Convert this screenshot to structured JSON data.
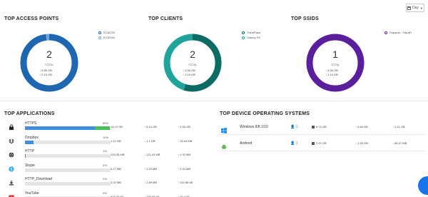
{
  "time_filter": {
    "value": "Day"
  },
  "sections": {
    "top_access_points": {
      "title": "TOP ACCESS POINTS",
      "total": "2",
      "total_label": "TOTAL",
      "down": "4.56 GB",
      "up": "2.19 GB",
      "legend": [
        "ECW230",
        "ECW160"
      ],
      "segments": [
        0.98,
        0.02
      ],
      "colors": [
        "#1f66b1",
        "#6aa6dc"
      ]
    },
    "top_clients": {
      "title": "TOP CLIENTS",
      "total": "2",
      "total_label": "TOTAL",
      "down": "4.56 GB",
      "up": "2.19 GB",
      "legend": [
        "ThinkPape",
        "Galaxy-S9"
      ],
      "segments": [
        0.55,
        0.45
      ],
      "colors": [
        "#0d6b64",
        "#20a39a"
      ]
    },
    "top_ssids": {
      "title": "TOP SSIDS",
      "total": "1",
      "total_label": "TOTAL",
      "down": "4.56 GB",
      "up": "2.19 GB",
      "legend": [
        "Papanet - PapaFi"
      ],
      "segments": [
        1.0
      ],
      "colors": [
        "#5b1f9e"
      ]
    }
  },
  "top_applications": {
    "title": "TOP APPLICATIONS",
    "rows": [
      {
        "name": "HTTPS",
        "pct": "89%",
        "total": "10.19 GB",
        "down": "8.14 GB",
        "up": "2.05 GB",
        "icon": "lock-icon",
        "blue": 0.82,
        "green": 0.17
      },
      {
        "name": "Dropbox",
        "pct": "10%",
        "total": "1.12 GB",
        "down": "1.1 GB",
        "up": "18.44 MB",
        "icon": "dropbox-icon",
        "blue": 0.1,
        "green": 0.0
      },
      {
        "name": "HTTP",
        "pct": "1%",
        "total": "126.35 MB",
        "down": "121.43 MB",
        "up": "4.92 MB",
        "icon": "globe-icon",
        "blue": 0.01,
        "green": 0.0
      },
      {
        "name": "Skype",
        "pct": "0%",
        "total": "5.27 MB",
        "down": "3.23 MB",
        "up": "2.04 MB",
        "icon": "skype-icon",
        "blue": 0.0,
        "green": 0.0
      },
      {
        "name": "HTTP_Download",
        "pct": "0%",
        "total": "3.02 MB",
        "down": "2.89 MB",
        "up": "132.86 kB",
        "icon": "download-icon",
        "blue": 0.0,
        "green": 0.0
      },
      {
        "name": "YouTube",
        "pct": "0%",
        "total": "825.05 kB",
        "down": "798.65 kB",
        "up": "26.4 kB",
        "icon": "youtube-icon",
        "blue": 0.0,
        "green": 0.0
      }
    ]
  },
  "top_device_os": {
    "title": "TOP DEVICE OPERATING SYSTEMS",
    "rows": [
      {
        "name": "Windows 8/8.1/10",
        "count": "1",
        "total": "6.74 GB",
        "down": "4.63 GB",
        "up": "2.11 GB",
        "icon": "windows-icon",
        "color": "#1e88e5"
      },
      {
        "name": "Android",
        "count": "1",
        "total": "2.02 GB",
        "down": "1.93 GB",
        "up": "86.47 MB",
        "icon": "android-icon",
        "color": "#5bb14a"
      }
    ]
  }
}
